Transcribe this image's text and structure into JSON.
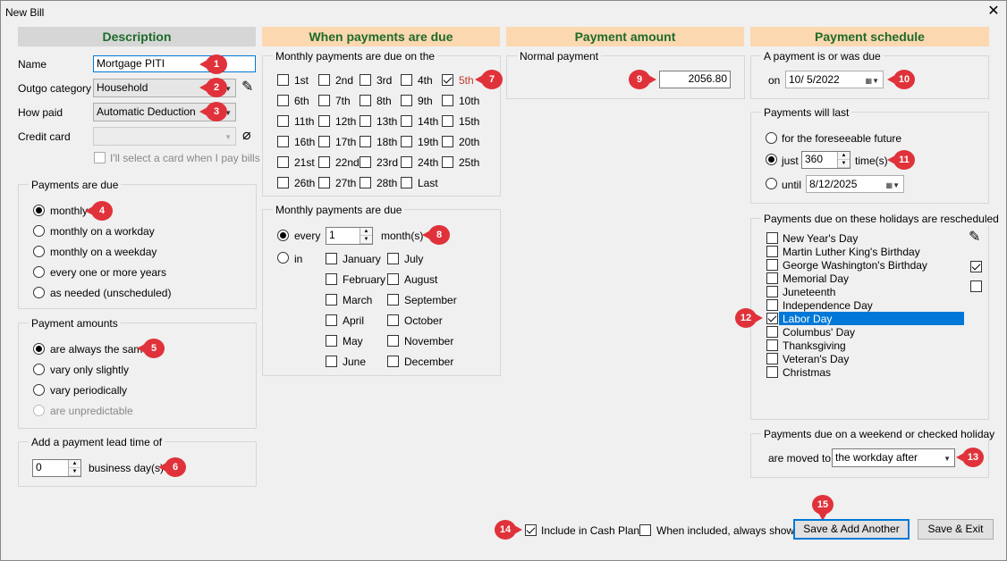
{
  "window": {
    "title": "New Bill"
  },
  "headers": {
    "description": "Description",
    "when_due": "When payments are due",
    "amount": "Payment amount",
    "schedule": "Payment schedule"
  },
  "description": {
    "name_label": "Name",
    "name_value": "Mortgage PITI",
    "outgo_label": "Outgo category",
    "outgo_value": "Household",
    "howpaid_label": "How paid",
    "howpaid_value": "Automatic Deduction",
    "card_label": "Credit card",
    "card_value": "",
    "card_later": "I'll select a card when I pay bills"
  },
  "payments_due": {
    "legend": "Payments are due",
    "options": [
      "monthly",
      "monthly on a workday",
      "monthly on a weekday",
      "every one or more years",
      "as needed (unscheduled)"
    ],
    "selected": 0
  },
  "payment_amounts": {
    "legend": "Payment amounts",
    "options": [
      "are always the same",
      "vary only slightly",
      "vary periodically",
      "are unpredictable"
    ],
    "selected": 0
  },
  "lead_time": {
    "legend": "Add a payment lead time of",
    "value": "0",
    "unit": "business day(s)"
  },
  "monthly_days": {
    "legend": "Monthly payments are due on the",
    "days": [
      "1st",
      "2nd",
      "3rd",
      "4th",
      "5th",
      "6th",
      "7th",
      "8th",
      "9th",
      "10th",
      "11th",
      "12th",
      "13th",
      "14th",
      "15th",
      "16th",
      "17th",
      "18th",
      "19th",
      "20th",
      "21st",
      "22nd",
      "23rd",
      "24th",
      "25th",
      "26th",
      "27th",
      "28th",
      "Last"
    ],
    "checked": [
      "5th"
    ]
  },
  "monthly_freq": {
    "legend": "Monthly payments are due",
    "every_label": "every",
    "every_value": "1",
    "every_unit": "month(s)",
    "in_label": "in",
    "months": [
      "January",
      "July",
      "February",
      "August",
      "March",
      "September",
      "April",
      "October",
      "May",
      "November",
      "June",
      "December"
    ]
  },
  "amount": {
    "legend": "Normal payment",
    "value": "2056.80"
  },
  "was_due": {
    "legend": "A payment is or was due",
    "on_label": "on",
    "date": "10/ 5/2022"
  },
  "will_last": {
    "legend": "Payments will last",
    "foreseeable": "for the foreseeable future",
    "just": "just",
    "just_value": "360",
    "times": "time(s)",
    "until": "until",
    "until_date": "8/12/2025",
    "selected": 1
  },
  "holidays": {
    "legend": "Payments due on these holidays are rescheduled",
    "items": [
      "New Year's Day",
      "Martin Luther King's Birthday",
      "George Washington's Birthday",
      "Memorial Day",
      "Juneteenth",
      "Independence Day",
      "Labor Day",
      "Columbus' Day",
      "Thanksgiving",
      "Veteran's Day",
      "Christmas"
    ],
    "checked": [
      "Labor Day"
    ],
    "selected": "Labor Day"
  },
  "weekend": {
    "legend": "Payments due on a weekend or checked holiday",
    "moved_label": "are moved to",
    "moved_value": "the workday after"
  },
  "footer": {
    "cash_plan": "Include in Cash Plan",
    "always_show": "When included, always show",
    "save_add": "Save & Add Another",
    "save_exit": "Save & Exit"
  },
  "badges": [
    "1",
    "2",
    "3",
    "4",
    "5",
    "6",
    "7",
    "8",
    "9",
    "10",
    "11",
    "12",
    "13",
    "14",
    "15"
  ],
  "colors": {
    "header_grey": "#d6d6d6",
    "header_orange": "#fcd8b0",
    "header_text": "#1e6b2a",
    "badge": "#e0323a",
    "selection": "#0078d7"
  }
}
